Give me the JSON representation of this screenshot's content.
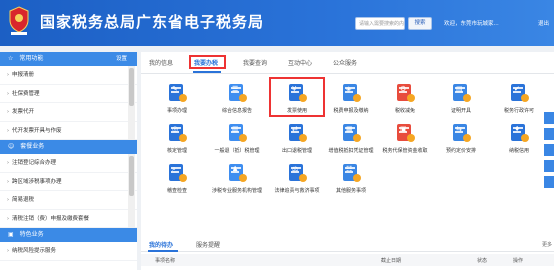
{
  "header": {
    "logo_caption": "中国税务",
    "title": "国家税务总局广东省电子税务局",
    "search_placeholder": "请输入需要搜索的内容",
    "search_button": "搜索",
    "welcome_text": "欢迎，东莞市玩城家...",
    "logout_text": "退出",
    "colors": {
      "header_bg": "#2a73d9",
      "accent": "#2a73d9",
      "highlight": "#ee3333"
    }
  },
  "sidebar": {
    "sections": [
      {
        "title": "常用功能",
        "action": "设置"
      },
      {
        "title": "套餐业务"
      },
      {
        "title": "特色业务"
      }
    ],
    "common_items": [
      "申报清册",
      "社保费管理",
      "发票代开",
      "代开发票开具与作废"
    ],
    "package_items": [
      "注销登记综合办理",
      "跨区域涉税事项办理",
      "简易退税",
      "清税注销（费）申报及缴费套餐"
    ],
    "special_items": [
      "纳税风险提示服务"
    ]
  },
  "main": {
    "tabs": [
      "我的信息",
      "我要办税",
      "我要查询",
      "互动中心",
      "公众服务"
    ],
    "active_tab_index": 1,
    "functions": [
      {
        "label": "事项办理",
        "icon": "document-edit-icon"
      },
      {
        "label": "综合信息报告",
        "icon": "report-clipboard-icon"
      },
      {
        "label": "发票使用",
        "icon": "invoice-yuan-icon",
        "highlighted": true
      },
      {
        "label": "税费申报及缴纳",
        "icon": "tax-declaration-shield-icon"
      },
      {
        "label": "税收减免",
        "icon": "tax-reduction-icon"
      },
      {
        "label": "证明开具",
        "icon": "certificate-icon"
      },
      {
        "label": "税务行政许可",
        "icon": "license-badge-icon"
      },
      {
        "label": "核定管理",
        "icon": "verification-user-icon"
      },
      {
        "label": "一般退（抵）税管理",
        "icon": "refund-clipboard-icon"
      },
      {
        "label": "出口退税管理",
        "icon": "export-refund-icon"
      },
      {
        "label": "增值税抵扣凭证管理",
        "icon": "vat-voucher-icon"
      },
      {
        "label": "税务代保管资金收取",
        "icon": "fund-custody-icon"
      },
      {
        "label": "预约定价安排",
        "icon": "pricing-arrangement-icon"
      },
      {
        "label": "纳税信用",
        "icon": "tax-credit-icon"
      },
      {
        "label": "稽查检查",
        "icon": "inspection-magnifier-icon"
      },
      {
        "label": "涉税专业服务机构管理",
        "icon": "professional-service-icon"
      },
      {
        "label": "法律追责与救济事项",
        "icon": "legal-gavel-icon"
      },
      {
        "label": "其他服务事项",
        "icon": "other-services-icon"
      }
    ],
    "todo": {
      "tabs": [
        "我的待办",
        "服务提醒"
      ],
      "more": "更多",
      "columns": [
        "事项名称",
        "截止日期",
        "状态",
        "操作"
      ]
    }
  }
}
